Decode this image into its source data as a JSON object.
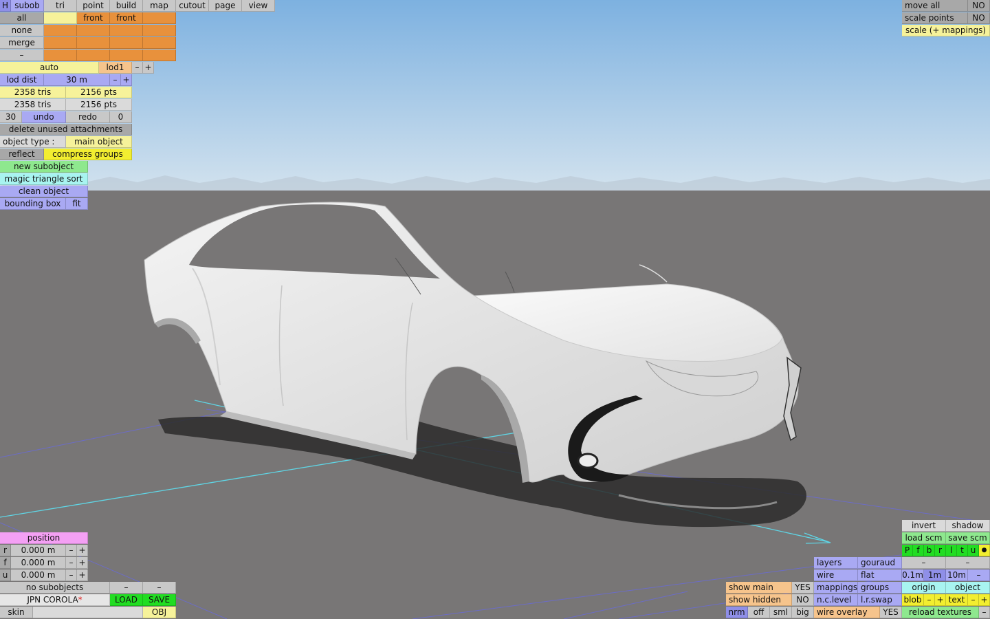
{
  "top_tabs": {
    "h": "H",
    "subob": "subob",
    "tri": "tri",
    "point": "point",
    "build": "build",
    "map": "map",
    "cutout": "cutout",
    "page": "page",
    "view": "view"
  },
  "subob_panel": {
    "all": "all",
    "none": "none",
    "merge": "merge",
    "dash": "–",
    "front1": "front",
    "front2": "front"
  },
  "lod": {
    "mode": "auto",
    "level": "lod1",
    "minus": "–",
    "plus": "+",
    "dist_label": "lod dist",
    "dist_value": "30 m"
  },
  "stats": {
    "tris1": "2358 tris",
    "pts1": "2156 pts",
    "tris2": "2358 tris",
    "pts2": "2156 pts"
  },
  "history": {
    "undo_count": "30",
    "undo": "undo",
    "redo": "redo",
    "redo_count": "0"
  },
  "actions": {
    "delete_unused": "delete unused attachments",
    "object_type_label": "object type :",
    "object_type_value": "main object",
    "reflect": "reflect",
    "compress_groups": "compress groups",
    "new_subobject": "new subobject",
    "magic_sort": "magic triangle sort",
    "clean_object": "clean object",
    "bounding_box": "bounding box",
    "fit": "fit"
  },
  "top_right": {
    "move_all": "move all",
    "move_all_val": "NO",
    "scale_points": "scale points",
    "scale_points_val": "NO",
    "scale_mappings": "scale (+ mappings)"
  },
  "position": {
    "title": "position",
    "rows": [
      {
        "axis": "r",
        "value": "0.000 m",
        "minus": "–",
        "plus": "+"
      },
      {
        "axis": "f",
        "value": "0.000 m",
        "minus": "–",
        "plus": "+"
      },
      {
        "axis": "u",
        "value": "0.000 m",
        "minus": "–",
        "plus": "+"
      }
    ]
  },
  "bottom_left": {
    "no_subobjects": "no subobjects",
    "dash1": "–",
    "dash2": "–",
    "model_name": "JPN COROLA",
    "modified_mark": "*",
    "load": "LOAD",
    "save": "SAVE",
    "skin": "skin",
    "obj": "OBJ"
  },
  "display": {
    "show_main": "show main",
    "show_main_val": "YES",
    "show_hidden": "show hidden",
    "show_hidden_val": "NO",
    "nrm": "nrm",
    "off": "off",
    "sml": "sml",
    "big": "big"
  },
  "render": {
    "layers": "layers",
    "gouraud": "gouraud",
    "wire": "wire",
    "flat": "flat",
    "mappings": "mappings",
    "groups": "groups",
    "nc_level": "n.c.level",
    "lr_swap": "l.r.swap",
    "wire_overlay": "wire overlay",
    "wire_overlay_val": "YES"
  },
  "right_tools": {
    "invert": "invert",
    "shadow": "shadow",
    "load_scm": "load scm",
    "save_scm": "save scm",
    "views": [
      "P",
      "f",
      "b",
      "r",
      "l",
      "t",
      "u"
    ],
    "dot": "●",
    "dash1": "–",
    "dash2": "–",
    "step_01": "0.1m",
    "step_1": "1m",
    "step_10": "10m",
    "step_minus": "–",
    "origin": "origin",
    "object": "object",
    "blob": "blob",
    "blob_minus": "–",
    "blob_plus": "+",
    "text": "text",
    "text_minus": "–",
    "text_plus": "+",
    "reload_textures": "reload textures",
    "reload_minus": "–"
  },
  "colors": {
    "sky_top": "#7fb2e0",
    "sky_bottom": "#cfe0ee",
    "ground": "#787676",
    "car_body": "#e9e9e9",
    "accent_orange": "#e8913c"
  }
}
